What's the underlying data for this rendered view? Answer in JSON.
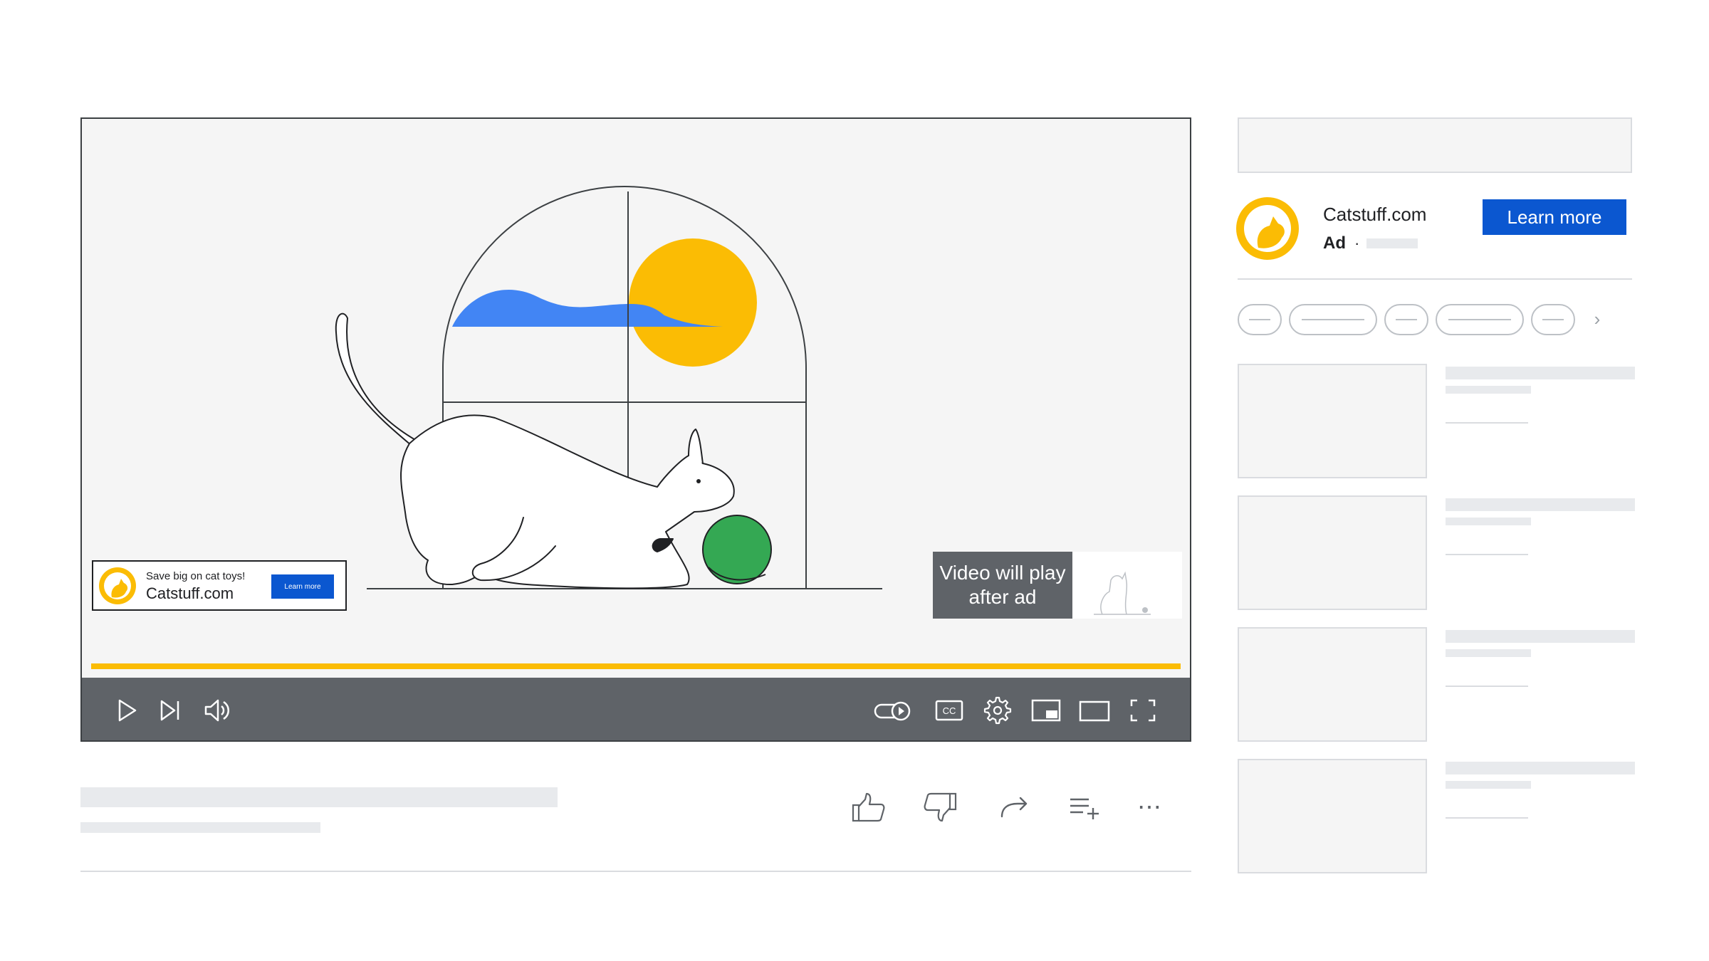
{
  "player": {
    "overlay_ad": {
      "tagline": "Save big on cat toys!",
      "domain": "Catstuff.com",
      "button_label": "Learn more"
    },
    "skip_message": "Video will play after ad",
    "ad_progress": 1.0,
    "controls": [
      "play",
      "next",
      "volume",
      "autoplay-toggle",
      "captions",
      "settings",
      "miniplayer",
      "theater-mode",
      "fullscreen"
    ],
    "captions_icon_text": "CC"
  },
  "actions": [
    "like",
    "dislike",
    "share",
    "save-to-playlist",
    "more"
  ],
  "more_glyph": "⋯",
  "sidebar": {
    "ad": {
      "domain": "Catstuff.com",
      "label": "Ad",
      "separator": "·",
      "button_label": "Learn more"
    },
    "chips_next_glyph": "›"
  },
  "colors": {
    "brand_yellow": "#fbbc04",
    "cta_blue": "#0b57d0",
    "controls_bg": "#5f6368",
    "sky_blue": "#4285f4",
    "ball_green": "#34a853",
    "skeleton": "#e8eaed"
  }
}
